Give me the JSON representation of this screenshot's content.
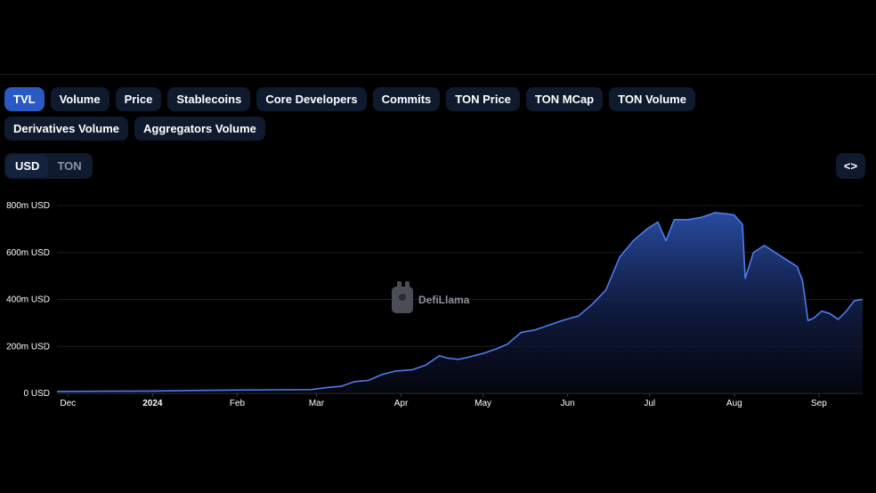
{
  "metric_tabs": [
    {
      "label": "TVL",
      "active": true
    },
    {
      "label": "Volume",
      "active": false
    },
    {
      "label": "Price",
      "active": false
    },
    {
      "label": "Stablecoins",
      "active": false
    },
    {
      "label": "Core Developers",
      "active": false
    },
    {
      "label": "Commits",
      "active": false
    },
    {
      "label": "TON Price",
      "active": false
    },
    {
      "label": "TON MCap",
      "active": false
    },
    {
      "label": "TON Volume",
      "active": false
    },
    {
      "label": "Derivatives Volume",
      "active": false
    },
    {
      "label": "Aggregators Volume",
      "active": false
    }
  ],
  "currency": {
    "options": [
      "USD",
      "TON"
    ],
    "selected": "USD"
  },
  "embed_label": "<>",
  "watermark": "DefiLlama",
  "colors": {
    "accent": "#2b59c3",
    "line": "#4f7bf0",
    "pill_bg": "#0f1a2e",
    "background": "#000000"
  },
  "chart_data": {
    "type": "area",
    "title": "",
    "xlabel": "",
    "ylabel": "",
    "unit": "USD",
    "x_range": [
      "2023-11-27",
      "2024-09-17"
    ],
    "ylim": [
      0,
      800
    ],
    "y_ticks": [
      {
        "value": 0,
        "label": "0 USD"
      },
      {
        "value": 200,
        "label": "200m USD"
      },
      {
        "value": 400,
        "label": "400m USD"
      },
      {
        "value": 600,
        "label": "600m USD"
      },
      {
        "value": 800,
        "label": "800m USD"
      }
    ],
    "x_ticks": [
      {
        "date": "2023-12-01",
        "label": "Dec",
        "bold": false
      },
      {
        "date": "2024-01-01",
        "label": "2024",
        "bold": true
      },
      {
        "date": "2024-02-01",
        "label": "Feb",
        "bold": false
      },
      {
        "date": "2024-03-01",
        "label": "Mar",
        "bold": false
      },
      {
        "date": "2024-04-01",
        "label": "Apr",
        "bold": false
      },
      {
        "date": "2024-05-01",
        "label": "May",
        "bold": false
      },
      {
        "date": "2024-06-01",
        "label": "Jun",
        "bold": false
      },
      {
        "date": "2024-07-01",
        "label": "Jul",
        "bold": false
      },
      {
        "date": "2024-08-01",
        "label": "Aug",
        "bold": false
      },
      {
        "date": "2024-09-01",
        "label": "Sep",
        "bold": false
      }
    ],
    "grid": true,
    "legend": "none",
    "series": [
      {
        "values_unit": "millions USD",
        "points": [
          [
            "2023-11-27",
            8
          ],
          [
            "2023-12-15",
            9
          ],
          [
            "2024-01-01",
            10
          ],
          [
            "2024-01-15",
            12
          ],
          [
            "2024-02-01",
            14
          ],
          [
            "2024-02-15",
            15
          ],
          [
            "2024-02-28",
            16
          ],
          [
            "2024-03-05",
            25
          ],
          [
            "2024-03-10",
            30
          ],
          [
            "2024-03-15",
            50
          ],
          [
            "2024-03-20",
            55
          ],
          [
            "2024-03-25",
            80
          ],
          [
            "2024-03-30",
            95
          ],
          [
            "2024-04-05",
            100
          ],
          [
            "2024-04-10",
            120
          ],
          [
            "2024-04-15",
            160
          ],
          [
            "2024-04-18",
            150
          ],
          [
            "2024-04-22",
            145
          ],
          [
            "2024-04-26",
            155
          ],
          [
            "2024-05-01",
            170
          ],
          [
            "2024-05-06",
            190
          ],
          [
            "2024-05-10",
            210
          ],
          [
            "2024-05-15",
            260
          ],
          [
            "2024-05-20",
            270
          ],
          [
            "2024-05-25",
            290
          ],
          [
            "2024-05-30",
            310
          ],
          [
            "2024-06-05",
            330
          ],
          [
            "2024-06-10",
            380
          ],
          [
            "2024-06-15",
            440
          ],
          [
            "2024-06-20",
            580
          ],
          [
            "2024-06-25",
            650
          ],
          [
            "2024-06-30",
            700
          ],
          [
            "2024-07-04",
            730
          ],
          [
            "2024-07-07",
            650
          ],
          [
            "2024-07-10",
            740
          ],
          [
            "2024-07-15",
            740
          ],
          [
            "2024-07-20",
            750
          ],
          [
            "2024-07-25",
            770
          ],
          [
            "2024-07-29",
            765
          ],
          [
            "2024-08-01",
            760
          ],
          [
            "2024-08-04",
            720
          ],
          [
            "2024-08-05",
            490
          ],
          [
            "2024-08-08",
            600
          ],
          [
            "2024-08-12",
            630
          ],
          [
            "2024-08-16",
            600
          ],
          [
            "2024-08-20",
            570
          ],
          [
            "2024-08-24",
            540
          ],
          [
            "2024-08-26",
            480
          ],
          [
            "2024-08-28",
            310
          ],
          [
            "2024-08-30",
            320
          ],
          [
            "2024-09-02",
            350
          ],
          [
            "2024-09-05",
            340
          ],
          [
            "2024-09-08",
            315
          ],
          [
            "2024-09-11",
            350
          ],
          [
            "2024-09-14",
            395
          ],
          [
            "2024-09-17",
            400
          ]
        ]
      }
    ]
  }
}
